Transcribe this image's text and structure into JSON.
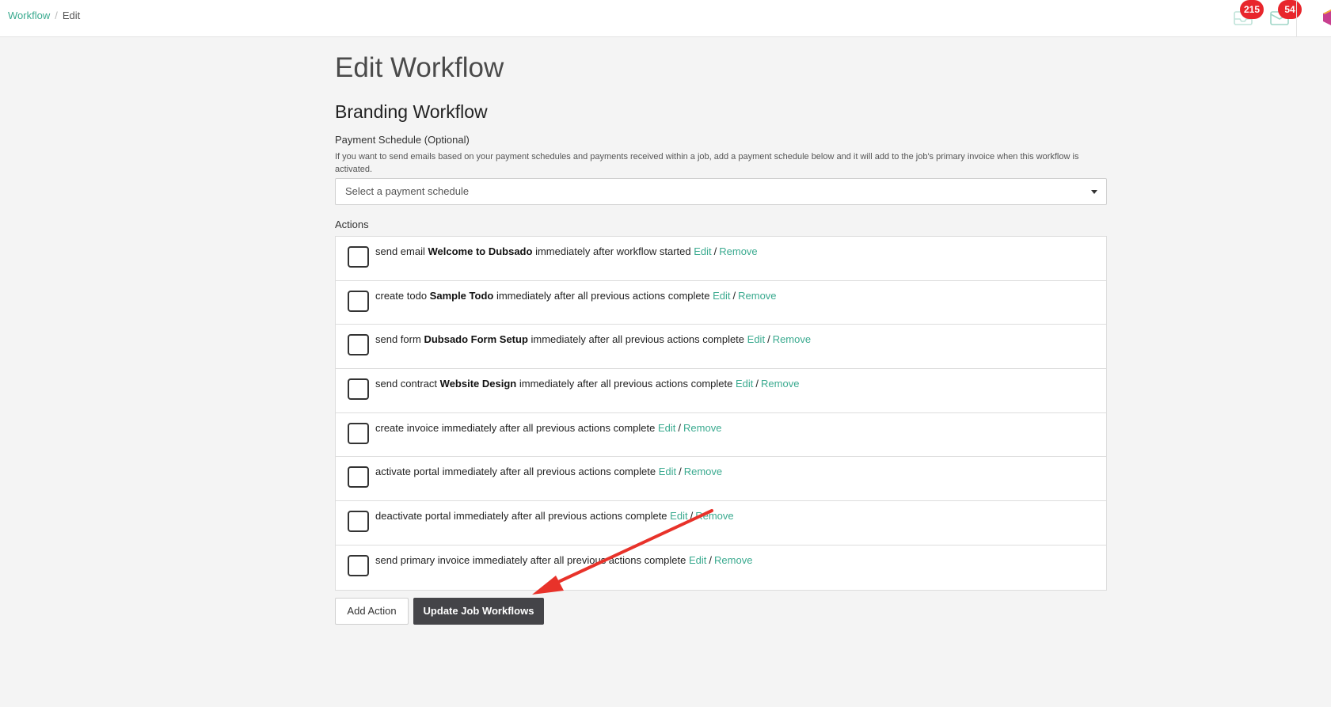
{
  "breadcrumb": {
    "root": "Workflow",
    "separator": "/",
    "current": "Edit"
  },
  "notifications": [
    {
      "icon": "inbox-icon",
      "count": "215"
    },
    {
      "icon": "mail-icon",
      "count": "54"
    }
  ],
  "page": {
    "title": "Edit Workflow",
    "workflow_name": "Branding Workflow"
  },
  "payment_schedule": {
    "label": "Payment Schedule (Optional)",
    "help": "If you want to send emails based on your payment schedules and payments received within a job, add a payment schedule below and it will add to the job's primary invoice when this workflow is activated.",
    "placeholder": "Select a payment schedule"
  },
  "actions": {
    "label": "Actions",
    "edit_label": "Edit",
    "remove_label": "Remove",
    "items": [
      {
        "verb": "send email",
        "target": "Welcome to Dubsado",
        "timing": "immediately after workflow started"
      },
      {
        "verb": "create todo",
        "target": "Sample Todo",
        "timing": "immediately after all previous actions complete"
      },
      {
        "verb": "send form",
        "target": "Dubsado Form Setup",
        "timing": "immediately after all previous actions complete"
      },
      {
        "verb": "send contract",
        "target": "Website Design",
        "timing": "immediately after all previous actions complete"
      },
      {
        "verb": "create invoice",
        "target": "",
        "timing": "immediately after all previous actions complete"
      },
      {
        "verb": "activate portal",
        "target": "",
        "timing": "immediately after all previous actions complete"
      },
      {
        "verb": "deactivate portal",
        "target": "",
        "timing": "immediately after all previous actions complete"
      },
      {
        "verb": "send primary invoice",
        "target": "",
        "timing": "immediately after all previous actions complete"
      }
    ]
  },
  "buttons": {
    "add_action": "Add Action",
    "update": "Update Job Workflows"
  },
  "colors": {
    "link": "#3aaa8f",
    "badge": "#e8262c",
    "primary_button": "#444448",
    "annotation_arrow": "#e8322a"
  }
}
